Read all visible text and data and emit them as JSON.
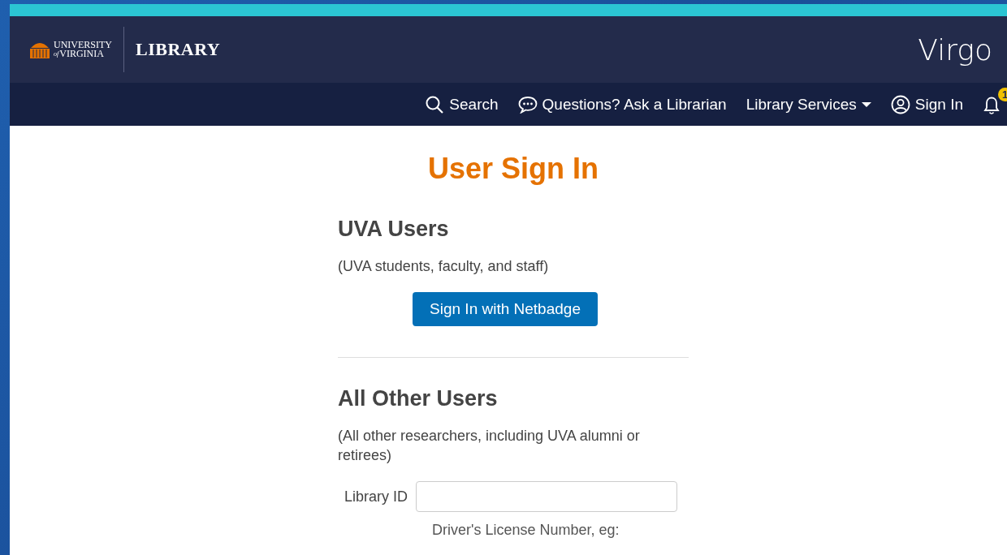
{
  "header": {
    "logo_top": "UNIVERSITY",
    "logo_bottom": "VIRGINIA",
    "logo_small": "of",
    "section": "LIBRARY",
    "app_name": "Virgo"
  },
  "nav": [
    {
      "kind": "search",
      "label": "Search"
    },
    {
      "kind": "chat",
      "label": "Questions? Ask a Librarian"
    },
    {
      "kind": "menu",
      "label": "Library Services"
    },
    {
      "kind": "user",
      "label": "Sign In"
    },
    {
      "kind": "bell",
      "badge": "1"
    }
  ],
  "title": "User Sign In",
  "uva": {
    "heading": "UVA Users",
    "note": "(UVA students, faculty, and staff)",
    "button": "Sign In with Netbadge"
  },
  "other": {
    "heading": "All Other Users",
    "note": "(All other researchers, including UVA alumni or retirees)",
    "field_label": "Library ID",
    "hint": "Driver's License Number, eg:"
  }
}
